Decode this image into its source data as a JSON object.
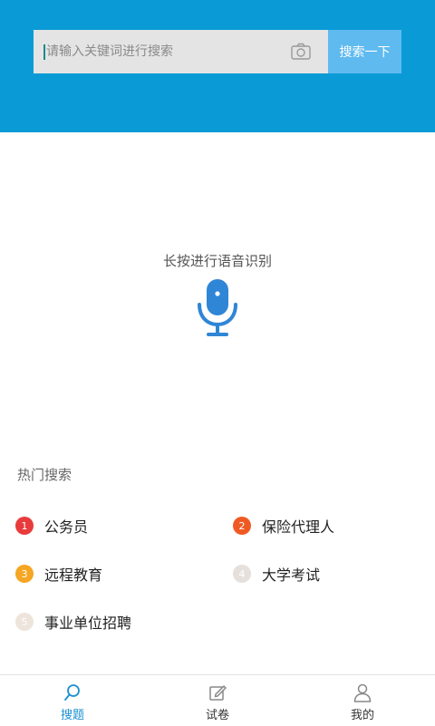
{
  "search": {
    "placeholder": "请输入关键词进行搜索",
    "value": "",
    "button_label": "搜索一下"
  },
  "voice": {
    "hint": "长按进行语音识别"
  },
  "hot": {
    "title": "热门搜索",
    "items": [
      {
        "rank": "1",
        "label": "公务员",
        "badge_color": "#e83b3b"
      },
      {
        "rank": "2",
        "label": "保险代理人",
        "badge_color": "#ef5a24"
      },
      {
        "rank": "3",
        "label": "远程教育",
        "badge_color": "#f5a623"
      },
      {
        "rank": "4",
        "label": "大学考试",
        "badge_color": "#e6e0dc"
      },
      {
        "rank": "5",
        "label": "事业单位招聘",
        "badge_color": "#ede4db"
      }
    ]
  },
  "tabs": [
    {
      "label": "搜题",
      "icon": "search-icon",
      "active": true
    },
    {
      "label": "试卷",
      "icon": "edit-icon",
      "active": false
    },
    {
      "label": "我的",
      "icon": "user-icon",
      "active": false
    }
  ],
  "colors": {
    "header": "#0a9bd6",
    "search_button": "#5fbaf0",
    "mic": "#2f86d6",
    "active_tab": "#1a8fd0"
  }
}
